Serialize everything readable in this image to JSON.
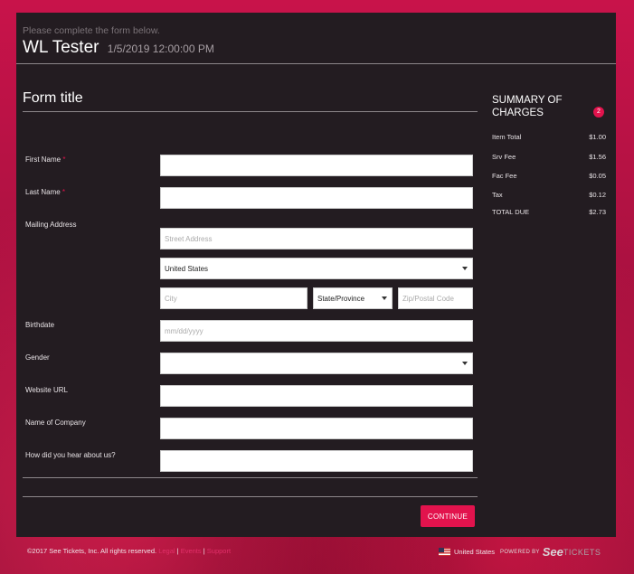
{
  "header": {
    "subtitle": "Please complete the form below.",
    "title": "WL Tester",
    "date": "1/5/2019 12:00:00 PM"
  },
  "form": {
    "title": "Form title",
    "first_name_label": "First Name",
    "last_name_label": "Last Name",
    "required_mark": "*",
    "mailing_label": "Mailing Address",
    "street_placeholder": "Street Address",
    "country_value": "United States",
    "city_placeholder": "City",
    "state_value": "State/Province",
    "zip_placeholder": "Zip/Postal Code",
    "birthdate_label": "Birthdate",
    "birthdate_placeholder": "mm/dd/yyyy",
    "gender_label": "Gender",
    "gender_value": "",
    "website_label": "Website URL",
    "company_label": "Name of Company",
    "hear_label": "How did you hear about us?",
    "continue_label": "CONTINUE"
  },
  "summary": {
    "title": "SUMMARY OF CHARGES",
    "badge": "2",
    "rows": [
      {
        "label": "Item Total",
        "value": "$1.00"
      },
      {
        "label": "Srv Fee",
        "value": "$1.56"
      },
      {
        "label": "Fac Fee",
        "value": "$0.05"
      },
      {
        "label": "Tax",
        "value": "$0.12"
      },
      {
        "label": "TOTAL DUE",
        "value": "$2.73"
      }
    ]
  },
  "footer": {
    "copyright": "©2017 See Tickets, Inc. All rights reserved.",
    "legal": "Legal",
    "events": "Events",
    "support": "Support",
    "divider": "|",
    "country": "United States",
    "powered_by": "POWERED BY",
    "brand_see": "See",
    "brand_tickets": "TICKETS"
  },
  "colors": {
    "accent": "#e2134d",
    "panel": "#231c21"
  }
}
